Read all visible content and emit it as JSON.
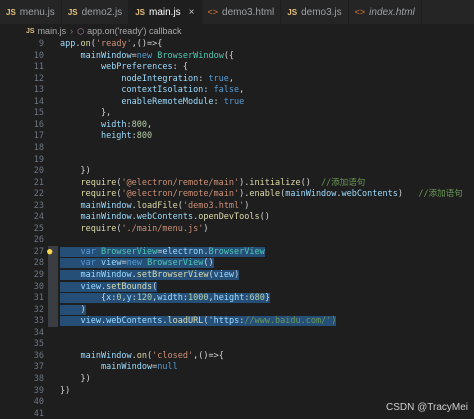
{
  "tabs": [
    {
      "type": "js",
      "label": "menu.js",
      "active": false
    },
    {
      "type": "js",
      "label": "demo2.js",
      "active": false
    },
    {
      "type": "js",
      "label": "main.js",
      "active": true,
      "close": "×"
    },
    {
      "type": "html",
      "label": "demo3.html",
      "active": false
    },
    {
      "type": "js",
      "label": "demo3.js",
      "active": false
    },
    {
      "type": "html",
      "label": "index.html",
      "active": false
    }
  ],
  "breadcrumb": {
    "file": "main.js",
    "symbol": "app.on('ready') callback",
    "sep": "›",
    "js_badge": "JS",
    "html_badge": "<>"
  },
  "lines": [
    {
      "n": "9",
      "code": "app.on('ready',()=>{"
    },
    {
      "n": "10",
      "code": "    mainWindow=new BrowserWindow({"
    },
    {
      "n": "11",
      "code": "        webPreferences: {"
    },
    {
      "n": "12",
      "code": "            nodeIntegration: true,"
    },
    {
      "n": "13",
      "code": "            contextIsolation: false,"
    },
    {
      "n": "14",
      "code": "            enableRemoteModule: true"
    },
    {
      "n": "15",
      "code": "        },"
    },
    {
      "n": "16",
      "code": "        width:800,"
    },
    {
      "n": "17",
      "code": "        height:800"
    },
    {
      "n": "18",
      "code": ""
    },
    {
      "n": "19",
      "code": ""
    },
    {
      "n": "20",
      "code": "    })"
    },
    {
      "n": "21",
      "code": "    require('@electron/remote/main').initialize()  //添加语句"
    },
    {
      "n": "22",
      "code": "    require('@electron/remote/main').enable(mainWindow.webContents)   //添加语句"
    },
    {
      "n": "23",
      "code": "    mainWindow.loadFile('demo3.html')"
    },
    {
      "n": "24",
      "code": "    mainWindow.webContents.openDevTools()"
    },
    {
      "n": "25",
      "code": "    require('./main/menu.js')"
    },
    {
      "n": "26",
      "code": ""
    },
    {
      "n": "27",
      "code": "    var BrowserView=electron.BrowserView"
    },
    {
      "n": "28",
      "code": "    var view=new BrowserView()"
    },
    {
      "n": "29",
      "code": "    mainWindow.setBrowserView(view)"
    },
    {
      "n": "30",
      "code": "    view.setBounds("
    },
    {
      "n": "31",
      "code": "        {x:0,y:120,width:1000,height:680}"
    },
    {
      "n": "32",
      "code": "    )"
    },
    {
      "n": "33",
      "code": "    view.webContents.loadURL('https://www.baidu.com/')"
    },
    {
      "n": "34",
      "code": ""
    },
    {
      "n": "35",
      "code": ""
    },
    {
      "n": "36",
      "code": "    mainWindow.on('closed',()=>{"
    },
    {
      "n": "37",
      "code": "        mainWindow=null"
    },
    {
      "n": "38",
      "code": "    })"
    },
    {
      "n": "39",
      "code": "})"
    },
    {
      "n": "40",
      "code": ""
    },
    {
      "n": "41",
      "code": ""
    }
  ],
  "selection": {
    "from_line": "27",
    "to_line": "33"
  },
  "lightbulb_line": "27",
  "watermark": "CSDN @TracyMei",
  "colors": {
    "keyword": "#569cd6",
    "variable": "#9cdcfe",
    "function": "#dcdcaa",
    "string": "#ce9178",
    "comment": "#6a9955",
    "number": "#b5cea8",
    "type": "#4ec9b0",
    "selection": "#264f78"
  }
}
